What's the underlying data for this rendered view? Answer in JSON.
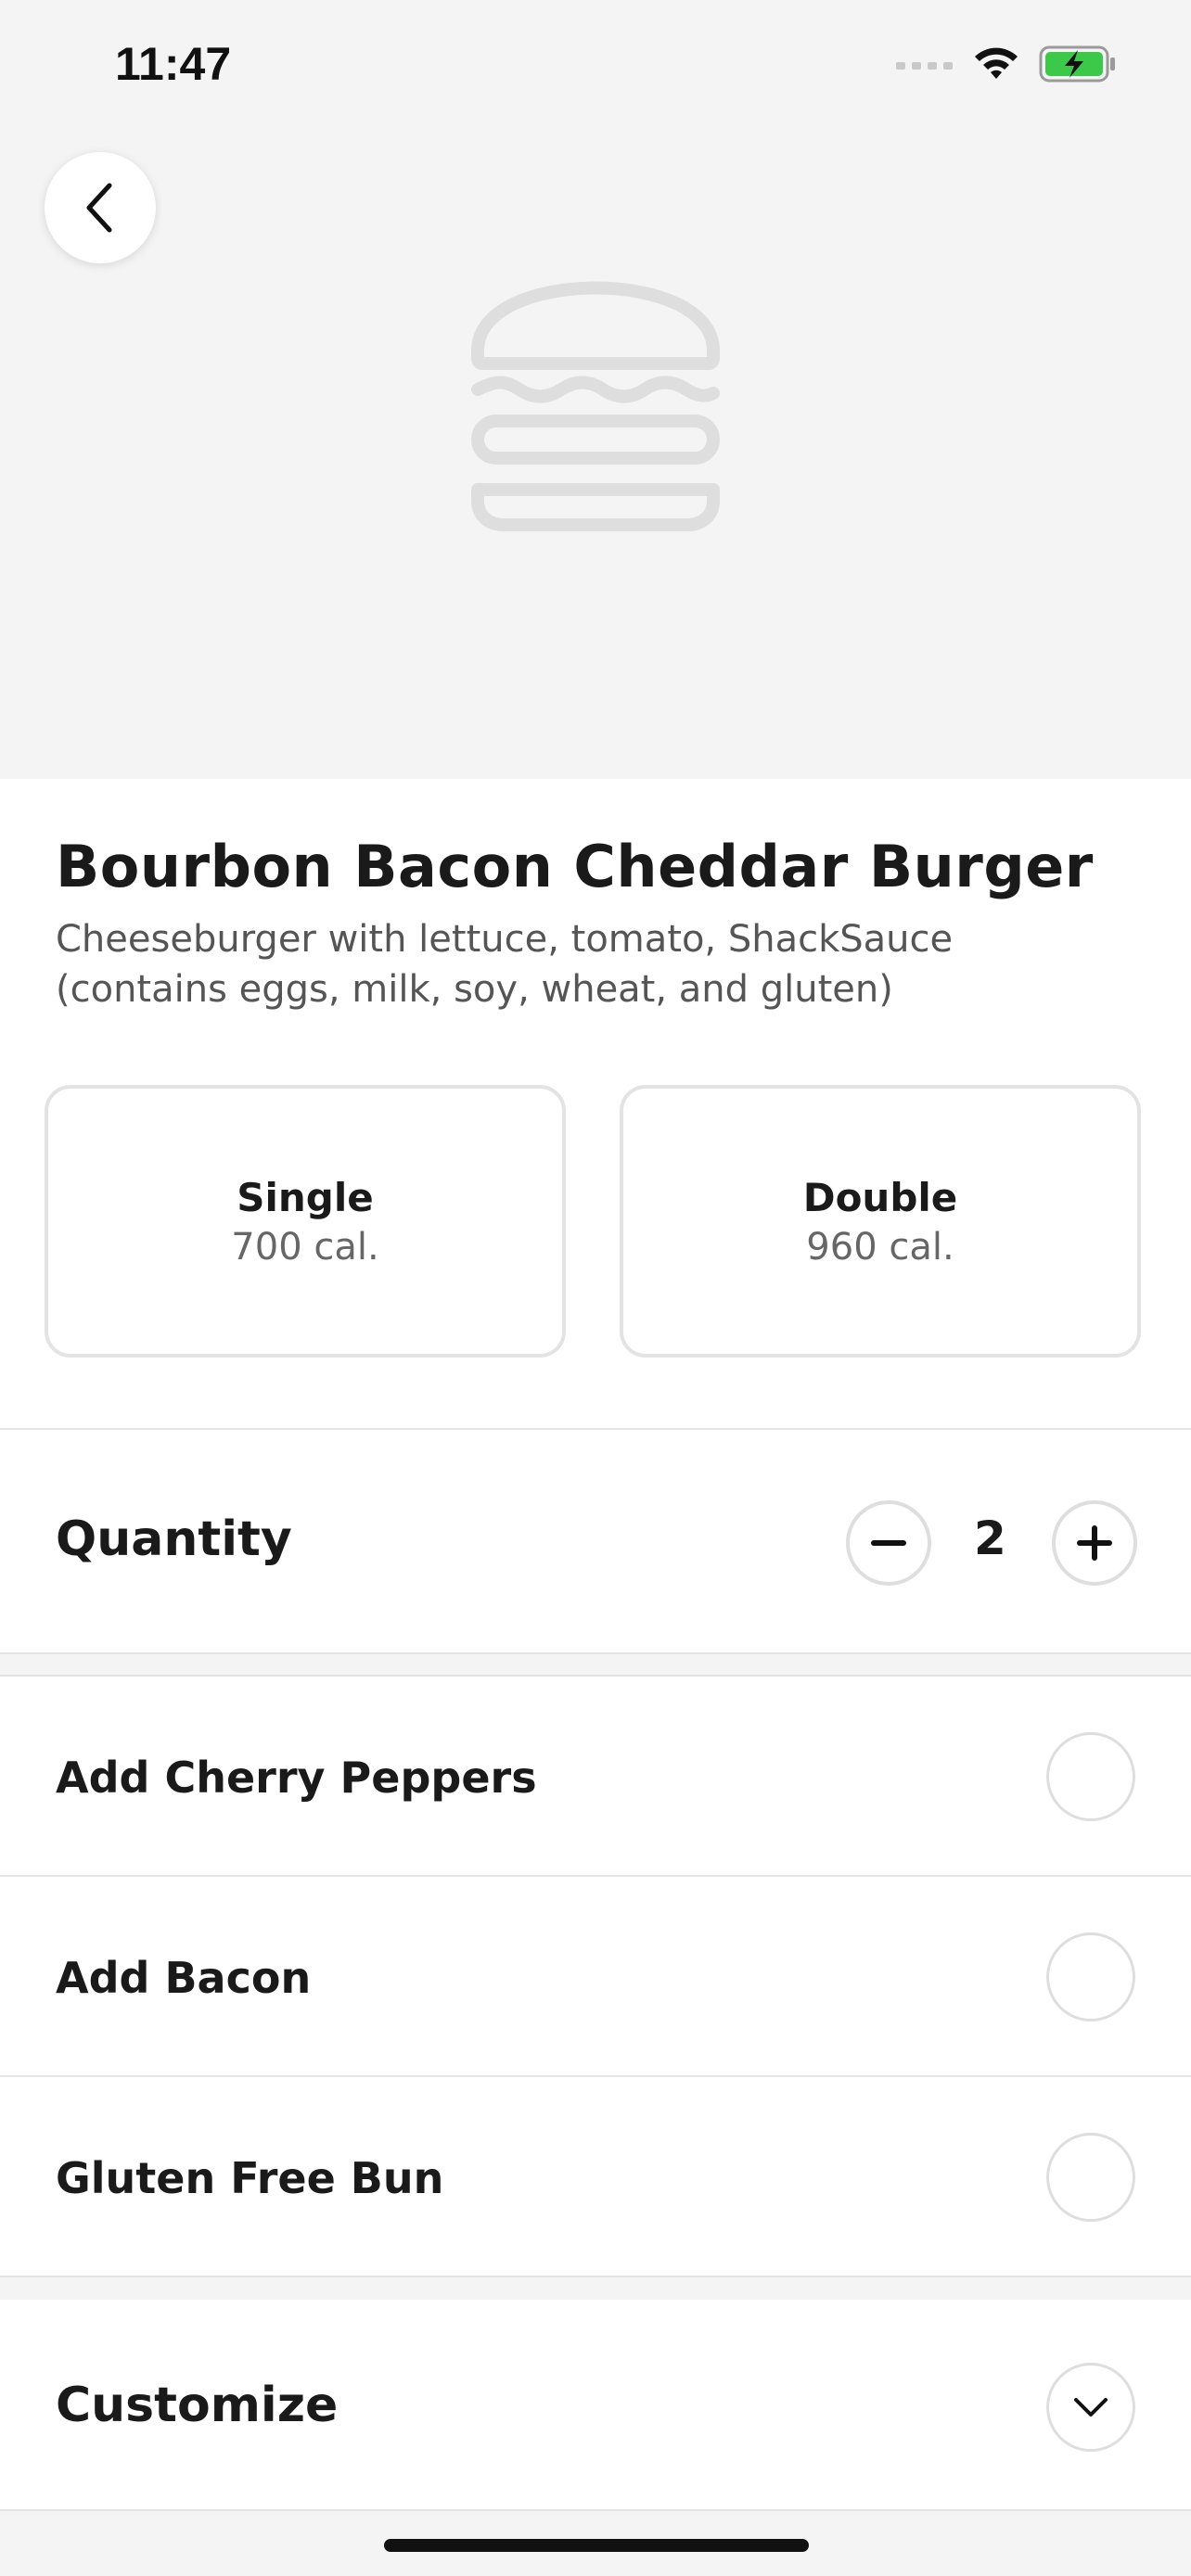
{
  "status_bar": {
    "time": "11:47",
    "icons": [
      "signal-icon",
      "wifi-icon",
      "battery-charging-icon"
    ]
  },
  "header": {
    "back_icon": "chevron-left-icon",
    "placeholder_image": "burger-icon"
  },
  "product": {
    "title": "Bourbon Bacon Cheddar Burger",
    "description": "Cheeseburger with lettuce, tomato, ShackSauce (contains eggs, milk, soy, wheat, and gluten)"
  },
  "sizes": [
    {
      "name": "Single",
      "calories": "700 cal."
    },
    {
      "name": "Double",
      "calories": "960 cal."
    }
  ],
  "quantity": {
    "label": "Quantity",
    "value": "2",
    "decrement_icon": "minus-icon",
    "increment_icon": "plus-icon"
  },
  "addons": [
    {
      "label": "Add Cherry Peppers",
      "selected": false
    },
    {
      "label": "Add Bacon",
      "selected": false
    },
    {
      "label": "Gluten Free Bun",
      "selected": false
    }
  ],
  "customize": {
    "label": "Customize",
    "icon": "chevron-down-icon"
  },
  "colors": {
    "hero_bg": "#f4f4f4",
    "border": "#e3e3e3",
    "text": "#1a1a1a",
    "muted": "#555555"
  }
}
